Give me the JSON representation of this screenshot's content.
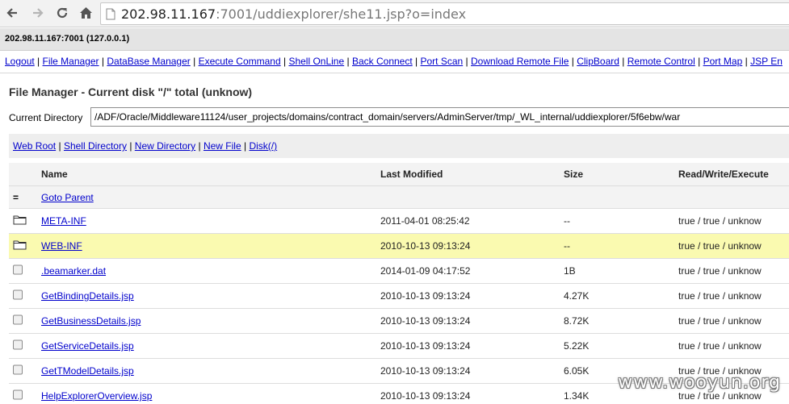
{
  "browser": {
    "url_host": "202.98.11.167",
    "url_rest": ":7001/uddiexplorer/she11.jsp?o=index"
  },
  "header": {
    "host": "202.98.11.167:7001 (127.0.0.1)"
  },
  "menu": [
    "Logout",
    "File Manager",
    "DataBase Manager",
    "Execute Command",
    "Shell OnLine",
    "Back Connect",
    "Port Scan",
    "Download Remote File",
    "ClipBoard",
    "Remote Control",
    "Port Map",
    "JSP En"
  ],
  "file_manager": {
    "title": "File Manager - Current disk \"/\" total (unknow)",
    "current_dir_label": "Current Directory",
    "current_dir_value": "/ADF/Oracle/Middleware11124/user_projects/domains/contract_domain/servers/AdminServer/tmp/_WL_internal/uddiexplorer/5f6ebw/war"
  },
  "subnav": [
    "Web Root",
    "Shell Directory",
    "New Directory",
    "New File",
    "Disk(/)"
  ],
  "table": {
    "headers": {
      "name": "Name",
      "modified": "Last Modified",
      "size": "Size",
      "rwx": "Read/Write/Execute"
    },
    "parent": "Goto Parent",
    "rows": [
      {
        "icon": "folder-icon",
        "name": "META-INF",
        "modified": "2011-04-01 08:25:42",
        "size": "--",
        "rwx": "true / true / unknow",
        "highlight": false
      },
      {
        "icon": "folder-icon",
        "name": "WEB-INF",
        "modified": "2010-10-13 09:13:24",
        "size": "--",
        "rwx": "true / true / unknow",
        "highlight": true
      },
      {
        "icon": "file-icon",
        "name": ".beamarker.dat",
        "modified": "2014-01-09 04:17:52",
        "size": "1B",
        "rwx": "true / true / unknow",
        "highlight": false
      },
      {
        "icon": "file-icon",
        "name": "GetBindingDetails.jsp",
        "modified": "2010-10-13 09:13:24",
        "size": "4.27K",
        "rwx": "true / true / unknow",
        "highlight": false
      },
      {
        "icon": "file-icon",
        "name": "GetBusinessDetails.jsp",
        "modified": "2010-10-13 09:13:24",
        "size": "8.72K",
        "rwx": "true / true / unknow",
        "highlight": false
      },
      {
        "icon": "file-icon",
        "name": "GetServiceDetails.jsp",
        "modified": "2010-10-13 09:13:24",
        "size": "5.22K",
        "rwx": "true / true / unknow",
        "highlight": false
      },
      {
        "icon": "file-icon",
        "name": "GetTModelDetails.jsp",
        "modified": "2010-10-13 09:13:24",
        "size": "6.05K",
        "rwx": "true / true / unknow",
        "highlight": false
      },
      {
        "icon": "file-icon",
        "name": "HelpExplorerOverview.jsp",
        "modified": "2010-10-13 09:13:24",
        "size": "1.34K",
        "rwx": "true / true / unknow",
        "highlight": false
      }
    ]
  },
  "watermark": "www.wooyun.org",
  "colors": {
    "link": "#0000cc",
    "highlight_row": "#fafab0",
    "header_row": "#f3f3f3"
  }
}
